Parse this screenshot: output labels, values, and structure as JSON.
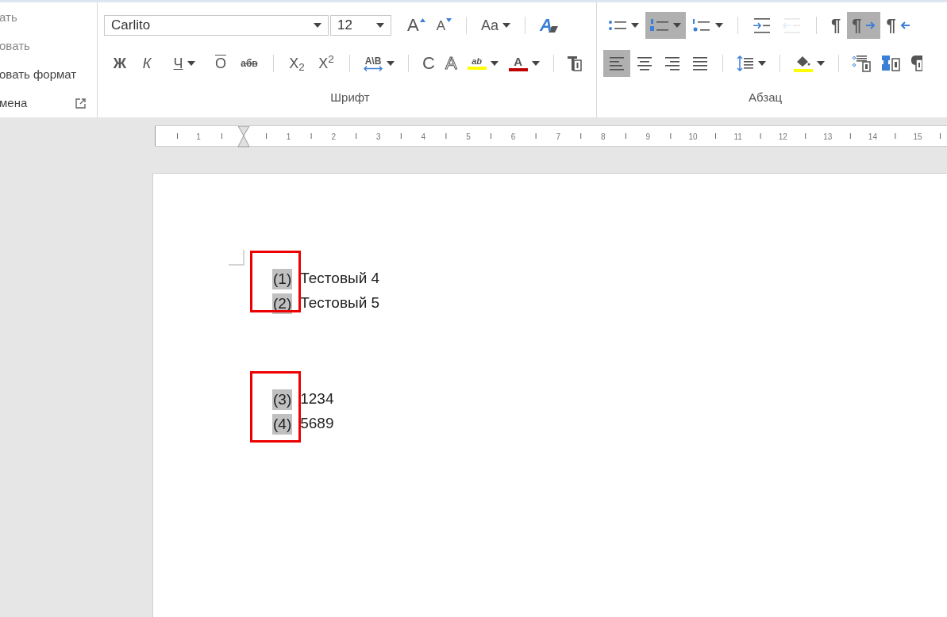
{
  "clipboard_group": {
    "items": [
      {
        "label": "ать"
      },
      {
        "label": "овать"
      },
      {
        "label": "овать формат"
      },
      {
        "label": "мена",
        "launcher": true
      }
    ]
  },
  "font_group": {
    "title": "Шрифт",
    "font_name": "Carlito",
    "font_size": "12",
    "row_1": [
      {
        "kind": "grow",
        "label": "A"
      },
      {
        "kind": "shrink",
        "label": "A"
      },
      {
        "kind": "separator"
      },
      {
        "kind": "case",
        "label": "Aa",
        "dropdown": true
      },
      {
        "kind": "separator"
      },
      {
        "kind": "clear",
        "label": "A"
      }
    ],
    "row_2": [
      {
        "kind": "bold",
        "label": "Ж"
      },
      {
        "kind": "italic",
        "label": "К"
      },
      {
        "kind": "underline",
        "label": "Ч",
        "dropdown": true
      },
      {
        "kind": "overline",
        "label": "О"
      },
      {
        "kind": "strike",
        "label": "абв"
      },
      {
        "kind": "separator"
      },
      {
        "kind": "script",
        "label": "X$_{2}$"
      },
      {
        "kind": "script",
        "label": "X$^{2}$"
      },
      {
        "kind": "separator"
      },
      {
        "kind": "spacing",
        "label": "A\\B",
        "dropdown": true
      },
      {
        "kind": "separator"
      },
      {
        "kind": "plain",
        "label": "C"
      },
      {
        "kind": "outline",
        "label": "A"
      },
      {
        "kind": "highlight",
        "label": "ab",
        "dropdown": true,
        "color": "#ffff00"
      },
      {
        "kind": "fontcolor",
        "label": "A",
        "dropdown": true,
        "color": "#c00000"
      },
      {
        "kind": "separator"
      },
      {
        "kind": "textbox"
      }
    ]
  },
  "paragraph_group": {
    "title": "Абзац",
    "row_1": [
      {
        "kind": "bullets",
        "dropdown": true,
        "selected": false,
        "disabled": false
      },
      {
        "kind": "numbering",
        "dropdown": true,
        "selected": true,
        "disabled": false
      },
      {
        "kind": "multilevel",
        "dropdown": true,
        "selected": false,
        "disabled": false
      },
      {
        "kind": "separator"
      },
      {
        "kind": "indent",
        "selected": false,
        "disabled": false
      },
      {
        "kind": "outdent",
        "selected": false,
        "disabled": true
      },
      {
        "kind": "separator"
      },
      {
        "kind": "pilcrow",
        "label": "¶",
        "selected": false,
        "disabled": false
      },
      {
        "kind": "pilcrow-right",
        "label": "¶",
        "selected": true,
        "disabled": false
      },
      {
        "kind": "pilcrow-left",
        "label": "¶",
        "selected": false,
        "disabled": false
      }
    ],
    "row_2": [
      {
        "kind": "align-left",
        "selected": true,
        "disabled": false
      },
      {
        "kind": "align-center",
        "selected": false,
        "disabled": false
      },
      {
        "kind": "align-right",
        "selected": false,
        "disabled": false
      },
      {
        "kind": "justify",
        "selected": false,
        "disabled": false
      },
      {
        "kind": "separator"
      },
      {
        "kind": "line-spacing",
        "dropdown": true,
        "selected": false,
        "disabled": false
      },
      {
        "kind": "separator"
      },
      {
        "kind": "shading",
        "dropdown": true,
        "selected": false,
        "disabled": false,
        "color": "#ffff00"
      },
      {
        "kind": "separator"
      },
      {
        "kind": "columns",
        "selected": false,
        "disabled": false
      },
      {
        "kind": "blocks",
        "selected": false,
        "disabled": false
      },
      {
        "kind": "frame",
        "selected": false,
        "disabled": false
      }
    ]
  },
  "ruler": {
    "labels": [
      "1",
      "1",
      "2",
      "3",
      "4",
      "5",
      "6",
      "7",
      "8",
      "9",
      "10",
      "11",
      "12",
      "13",
      "14",
      "15"
    ]
  },
  "document": {
    "lists": [
      {
        "marked": true,
        "items": [
          {
            "number": "(1)",
            "text": "Тестовый 4"
          },
          {
            "number": "(2)",
            "text": "Тестовый 5"
          }
        ]
      },
      {
        "marked": true,
        "items": [
          {
            "number": "(3)",
            "text": "1234"
          },
          {
            "number": "(4)",
            "text": "5689"
          }
        ]
      }
    ]
  }
}
